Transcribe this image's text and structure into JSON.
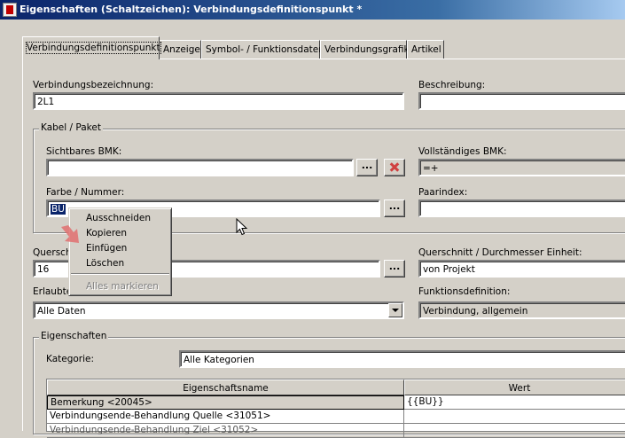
{
  "window": {
    "title": "Eigenschaften (Schaltzeichen): Verbindungsdefinitionspunkt *"
  },
  "tabs": [
    {
      "label": "Verbindungsdefinitionspunkt",
      "active": true
    },
    {
      "label": "Anzeige"
    },
    {
      "label": "Symbol- / Funktionsdaten"
    },
    {
      "label": "Verbindungsgrafik"
    },
    {
      "label": "Artikel"
    }
  ],
  "form": {
    "verbindungsbezeichnung": {
      "label": "Verbindungsbezeichnung:",
      "value": "2L1"
    },
    "beschreibung": {
      "label": "Beschreibung:",
      "value": ""
    },
    "kabel_group": {
      "title": "Kabel / Paket"
    },
    "sichtbares_bmk": {
      "label": "Sichtbares BMK:",
      "value": ""
    },
    "vollstaendiges_bmk": {
      "label": "Vollständiges BMK:",
      "value": "=+"
    },
    "farbe_nummer": {
      "label": "Farbe / Nummer:",
      "value": "BU"
    },
    "paarindex": {
      "label": "Paarindex:",
      "value": ""
    },
    "querschnitt": {
      "label": "Querschnitt / Durchmesser:",
      "label_visible": "Querschi",
      "value": "16"
    },
    "querschnitt_einheit": {
      "label": "Querschnitt / Durchmesser Einheit:",
      "value": "von Projekt"
    },
    "erlaubte": {
      "label_visible": "Erlaubte",
      "value": "Alle Daten"
    },
    "funktionsdefinition": {
      "label": "Funktionsdefinition:",
      "value": "Verbindung, allgemein"
    },
    "browse_label": "...",
    "eigenschaften_group": {
      "title": "Eigenschaften"
    },
    "kategorie": {
      "label": "Kategorie:",
      "value": "Alle Kategorien"
    }
  },
  "properties_table": {
    "columns": [
      "Eigenschaftsname",
      "Wert"
    ],
    "rows": [
      {
        "name": "Bemerkung <20045>",
        "value": "{{BU}}"
      },
      {
        "name": "Verbindungsende-Behandlung Quelle <31051>",
        "value": ""
      },
      {
        "name": "Verbindungsende-Behandlung Ziel <31052>",
        "value": ""
      }
    ]
  },
  "context_menu": {
    "items": [
      {
        "label": "Ausschneiden",
        "enabled": true
      },
      {
        "label": "Kopieren",
        "enabled": true
      },
      {
        "label": "Einfügen",
        "enabled": true
      },
      {
        "label": "Löschen",
        "enabled": true
      },
      {
        "label": "Alles markieren",
        "enabled": false
      }
    ]
  },
  "colors": {
    "titlebar": "#0a246a",
    "face": "#d4d0c8",
    "delete_icon": "#d04040",
    "hint_arrow": "#e07070"
  }
}
